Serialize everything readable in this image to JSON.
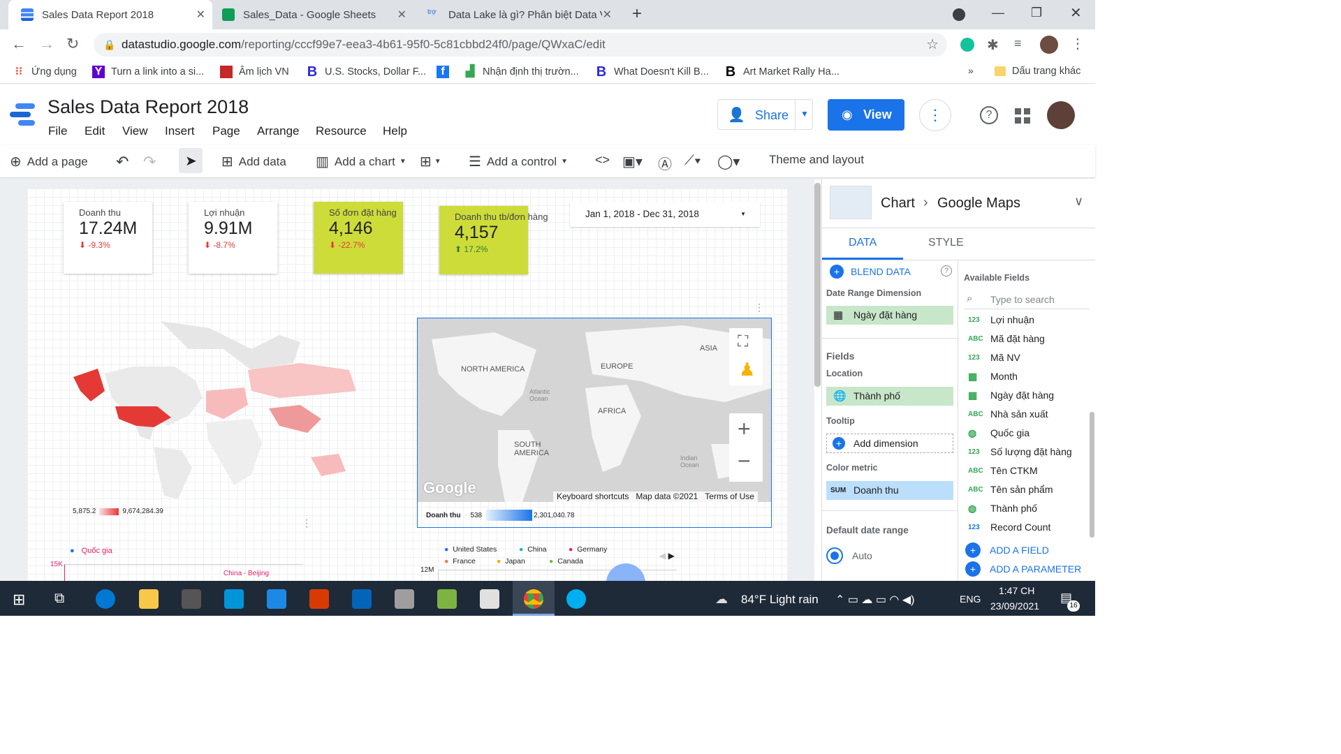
{
  "browser": {
    "tabs": [
      {
        "title": "Sales Data Report 2018",
        "color": "#4285f4"
      },
      {
        "title": "Sales_Data - Google Sheets",
        "color": "#0f9d58"
      },
      {
        "title": "Data Lake là gì? Phân biệt Data V",
        "color": "#1a73e8"
      }
    ],
    "url_domain": "datastudio.google.com",
    "url_path": "/reporting/cccf99e7-eea3-4b61-95f0-5c81cbbd24f0/page/QWxaC/edit",
    "bookmarks": [
      "Ứng dụng",
      "Turn a link into a si...",
      "Âm lịch VN",
      "U.S. Stocks, Dollar F...",
      "Nhận định thị trườn...",
      "What Doesn't Kill B...",
      "Art Market Rally Ha..."
    ],
    "other_bookmarks": "Dấu trang khác"
  },
  "app": {
    "title": "Sales Data Report 2018",
    "menu": [
      "File",
      "Edit",
      "View",
      "Insert",
      "Page",
      "Arrange",
      "Resource",
      "Help"
    ],
    "share": "Share",
    "view": "View"
  },
  "toolbar": {
    "add_page": "Add a page",
    "add_data": "Add data",
    "add_chart": "Add a chart",
    "add_control": "Add a control",
    "theme": "Theme and layout"
  },
  "scorecards": [
    {
      "label": "Doanh thu",
      "value": "17.24M",
      "delta": "-9.3%"
    },
    {
      "label": "Lợi nhuận",
      "value": "9.91M",
      "delta": "-8.7%"
    },
    {
      "label": "Số đơn đặt hàng",
      "value": "4,146",
      "delta": "-22.7%"
    },
    {
      "label": "Doanh thu tb/đơn hàng",
      "value": "4,157",
      "delta": "17.2%"
    }
  ],
  "date_range": "Jan 1, 2018 - Dec 31, 2018",
  "geo_legend": {
    "min": "5,875.2",
    "max": "9,674,284.39"
  },
  "map": {
    "labels": [
      "NORTH AMERICA",
      "EUROPE",
      "ASIA",
      "AFRICA",
      "SOUTH AMERICA",
      "Atlantic Ocean",
      "Indian Ocean"
    ],
    "footer": [
      "Keyboard shortcuts",
      "Map data ©2021",
      "Terms of Use"
    ],
    "logo": "Google",
    "legend_metric": "Doanh thu",
    "legend_min": "538",
    "legend_max": "2,301,040.78"
  },
  "bottom_left": {
    "legend": "Quốc gia",
    "tick": "15K",
    "label": "China - Beijing"
  },
  "bottom_right": {
    "legend": [
      "United States",
      "China",
      "Germany",
      "France",
      "Japan",
      "Canada"
    ],
    "tick": "12M"
  },
  "panel": {
    "chart": "Chart",
    "chart_type": "Google Maps",
    "tabs": [
      "DATA",
      "STYLE"
    ],
    "blend": "BLEND DATA",
    "date_range_dim_label": "Date Range Dimension",
    "date_range_dim": "Ngày đặt hàng",
    "fields_label": "Fields",
    "location_label": "Location",
    "location": "Thành phố",
    "tooltip_label": "Tooltip",
    "add_dimension": "Add dimension",
    "color_metric_label": "Color metric",
    "color_metric_agg": "SUM",
    "color_metric": "Doanh thu",
    "default_date_label": "Default date range",
    "default_date": "Auto",
    "available_label": "Available Fields",
    "search_placeholder": "Type to search",
    "fields": [
      {
        "type": "123",
        "name": "Lợi nhuận"
      },
      {
        "type": "ABC",
        "name": "Mã đặt hàng"
      },
      {
        "type": "123",
        "name": "Mã NV"
      },
      {
        "type": "date",
        "name": "Month"
      },
      {
        "type": "date",
        "name": "Ngày đặt hàng"
      },
      {
        "type": "ABC",
        "name": "Nhà sản xuất"
      },
      {
        "type": "geo",
        "name": "Quốc gia"
      },
      {
        "type": "123",
        "name": "Số lượng đặt hàng"
      },
      {
        "type": "ABC",
        "name": "Tên CTKM"
      },
      {
        "type": "ABC",
        "name": "Tên sản phẩm"
      },
      {
        "type": "geo",
        "name": "Thành phố"
      },
      {
        "type": "123",
        "name": "Record Count"
      }
    ],
    "add_field": "ADD A FIELD",
    "add_param": "ADD A PARAMETER"
  },
  "taskbar": {
    "weather": "84°F  Light rain",
    "lang": "ENG",
    "time": "1:47 CH",
    "date": "23/09/2021",
    "notif": "16"
  }
}
